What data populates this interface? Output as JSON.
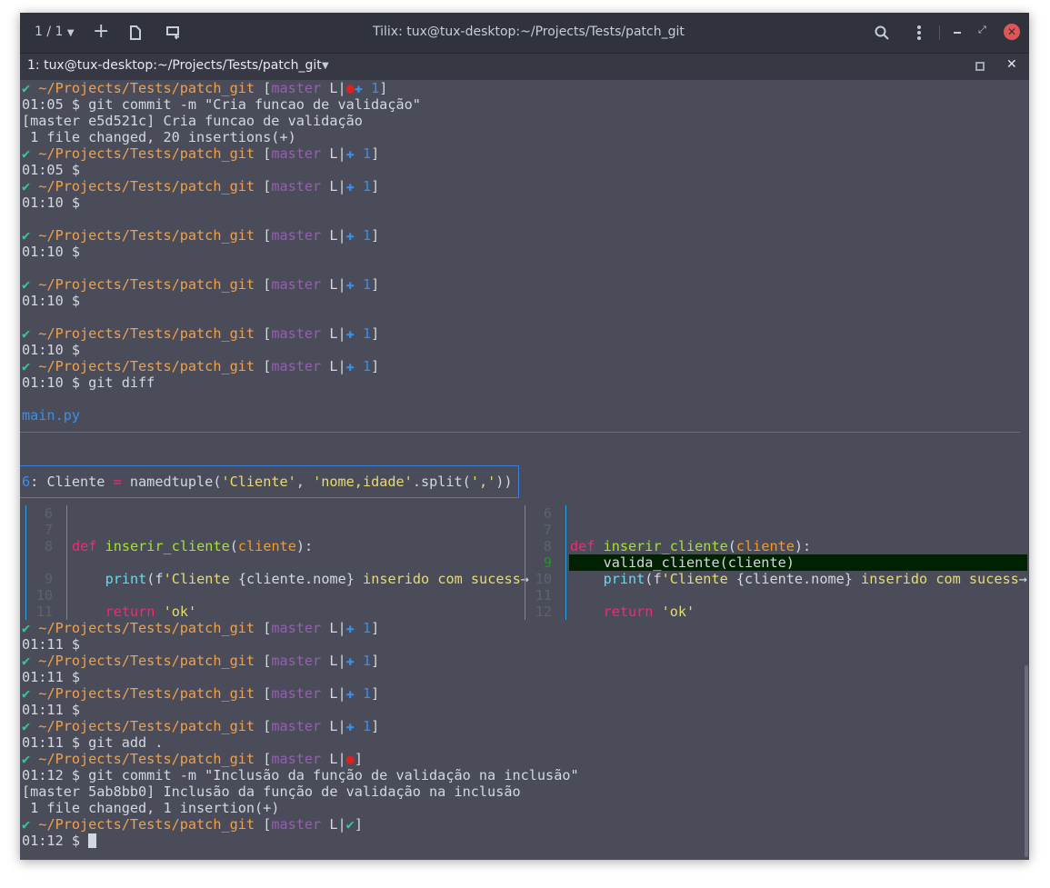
{
  "colors": {
    "fg": "#d3d7de",
    "path": "#f0a04b",
    "branch": "#9a5cb4",
    "check": "#3ec29a",
    "blue": "#3b8eea",
    "red": "#e0201e",
    "kw": "#f92672",
    "func": "#a6e22e",
    "param": "#fd971f",
    "str": "#e6db74",
    "builtin": "#66d9ef",
    "num": "#5e626c",
    "addnum": "#1f9a1f",
    "file": "#3b8eea",
    "close": "#e05555"
  },
  "titlebar": {
    "session_label": "1 / 1",
    "title": "Tilix: tux@tux-desktop:~/Projects/Tests/patch_git"
  },
  "tab": {
    "label": "1: tux@tux-desktop:~/Projects/Tests/patch_git"
  },
  "terminal": {
    "before": [
      [
        [
          "✔ ",
          "check"
        ],
        [
          "~/Projects/Tests/patch_git ",
          "path"
        ],
        [
          "[",
          "fg"
        ],
        [
          "master",
          "branch"
        ],
        [
          " L|",
          "fg"
        ],
        [
          "●",
          "red"
        ],
        [
          "✚",
          "blue"
        ],
        [
          " 1",
          "blue"
        ],
        [
          "]",
          "fg"
        ]
      ],
      [
        [
          "01:05 $ git commit -m \"Cria funcao de validação\"",
          "fg"
        ]
      ],
      [
        [
          "[master e5d521c] Cria funcao de validação",
          "fg"
        ]
      ],
      [
        [
          " 1 file changed, 20 insertions(+)",
          "fg"
        ]
      ],
      [
        [
          "✔ ",
          "check"
        ],
        [
          "~/Projects/Tests/patch_git ",
          "path"
        ],
        [
          "[",
          "fg"
        ],
        [
          "master",
          "branch"
        ],
        [
          " L|",
          "fg"
        ],
        [
          "✚",
          "blue"
        ],
        [
          " 1",
          "blue"
        ],
        [
          "]",
          "fg"
        ]
      ],
      [
        [
          "01:05 $",
          "fg"
        ]
      ],
      [
        [
          "✔ ",
          "check"
        ],
        [
          "~/Projects/Tests/patch_git ",
          "path"
        ],
        [
          "[",
          "fg"
        ],
        [
          "master",
          "branch"
        ],
        [
          " L|",
          "fg"
        ],
        [
          "✚",
          "blue"
        ],
        [
          " 1",
          "blue"
        ],
        [
          "]",
          "fg"
        ]
      ],
      [
        [
          "01:10 $",
          "fg"
        ]
      ],
      [],
      [
        [
          "✔ ",
          "check"
        ],
        [
          "~/Projects/Tests/patch_git ",
          "path"
        ],
        [
          "[",
          "fg"
        ],
        [
          "master",
          "branch"
        ],
        [
          " L|",
          "fg"
        ],
        [
          "✚",
          "blue"
        ],
        [
          " 1",
          "blue"
        ],
        [
          "]",
          "fg"
        ]
      ],
      [
        [
          "01:10 $",
          "fg"
        ]
      ],
      [],
      [
        [
          "✔ ",
          "check"
        ],
        [
          "~/Projects/Tests/patch_git ",
          "path"
        ],
        [
          "[",
          "fg"
        ],
        [
          "master",
          "branch"
        ],
        [
          " L|",
          "fg"
        ],
        [
          "✚",
          "blue"
        ],
        [
          " 1",
          "blue"
        ],
        [
          "]",
          "fg"
        ]
      ],
      [
        [
          "01:10 $",
          "fg"
        ]
      ],
      [],
      [
        [
          "✔ ",
          "check"
        ],
        [
          "~/Projects/Tests/patch_git ",
          "path"
        ],
        [
          "[",
          "fg"
        ],
        [
          "master",
          "branch"
        ],
        [
          " L|",
          "fg"
        ],
        [
          "✚",
          "blue"
        ],
        [
          " 1",
          "blue"
        ],
        [
          "]",
          "fg"
        ]
      ],
      [
        [
          "01:10 $",
          "fg"
        ]
      ],
      [
        [
          "✔ ",
          "check"
        ],
        [
          "~/Projects/Tests/patch_git ",
          "path"
        ],
        [
          "[",
          "fg"
        ],
        [
          "master",
          "branch"
        ],
        [
          " L|",
          "fg"
        ],
        [
          "✚",
          "blue"
        ],
        [
          " 1",
          "blue"
        ],
        [
          "]",
          "fg"
        ]
      ],
      [
        [
          "01:10 $ git diff",
          "fg"
        ]
      ],
      [],
      [
        [
          "main.py",
          "file"
        ]
      ]
    ],
    "diff": {
      "hunk": [
        [
          "6",
          "blue"
        ],
        [
          ": Cliente ",
          "fg"
        ],
        [
          "=",
          "kw"
        ],
        [
          " namedtuple(",
          "fg"
        ],
        [
          "'Cliente'",
          "str"
        ],
        [
          ", ",
          "fg"
        ],
        [
          "'nome,idade'",
          "str"
        ],
        [
          ".split(",
          "fg"
        ],
        [
          "','",
          "str"
        ],
        [
          "))",
          "fg"
        ]
      ],
      "left": [
        {
          "n": "6",
          "code": []
        },
        {
          "n": "7",
          "code": []
        },
        {
          "n": "8",
          "code": [
            [
              "def ",
              "kw"
            ],
            [
              "inserir_cliente",
              "func"
            ],
            [
              "(",
              "fg"
            ],
            [
              "cliente",
              "param"
            ],
            [
              "):",
              "fg"
            ]
          ]
        },
        {
          "n": "",
          "code": []
        },
        {
          "n": "9",
          "code": [
            [
              "    ",
              "fg"
            ],
            [
              "print",
              "builtin"
            ],
            [
              "(f",
              "fg"
            ],
            [
              "'Cliente ",
              "str"
            ],
            [
              "{cliente.nome}",
              "fg"
            ],
            [
              " inserido com sucess",
              "str"
            ],
            [
              "→",
              "fg"
            ]
          ]
        },
        {
          "n": "10",
          "code": []
        },
        {
          "n": "11",
          "code": [
            [
              "    ",
              "fg"
            ],
            [
              "return ",
              "kw"
            ],
            [
              "'ok'",
              "str"
            ]
          ]
        }
      ],
      "right": [
        {
          "n": "6",
          "code": []
        },
        {
          "n": "7",
          "code": []
        },
        {
          "n": "8",
          "code": [
            [
              "def ",
              "kw"
            ],
            [
              "inserir_cliente",
              "func"
            ],
            [
              "(",
              "fg"
            ],
            [
              "cliente",
              "param"
            ],
            [
              "):",
              "fg"
            ]
          ]
        },
        {
          "n": "9",
          "added": true,
          "code": [
            [
              "    valida_cliente(cliente)",
              "fg"
            ]
          ]
        },
        {
          "n": "10",
          "code": [
            [
              "    ",
              "fg"
            ],
            [
              "print",
              "builtin"
            ],
            [
              "(f",
              "fg"
            ],
            [
              "'Cliente ",
              "str"
            ],
            [
              "{cliente.nome}",
              "fg"
            ],
            [
              " inserido com sucess",
              "str"
            ],
            [
              "→",
              "fg"
            ]
          ]
        },
        {
          "n": "11",
          "code": []
        },
        {
          "n": "12",
          "code": [
            [
              "    ",
              "fg"
            ],
            [
              "return ",
              "kw"
            ],
            [
              "'ok'",
              "str"
            ]
          ]
        }
      ]
    },
    "after": [
      [
        [
          "✔ ",
          "check"
        ],
        [
          "~/Projects/Tests/patch_git ",
          "path"
        ],
        [
          "[",
          "fg"
        ],
        [
          "master",
          "branch"
        ],
        [
          " L|",
          "fg"
        ],
        [
          "✚",
          "blue"
        ],
        [
          " 1",
          "blue"
        ],
        [
          "]",
          "fg"
        ]
      ],
      [
        [
          "01:11 $",
          "fg"
        ]
      ],
      [
        [
          "✔ ",
          "check"
        ],
        [
          "~/Projects/Tests/patch_git ",
          "path"
        ],
        [
          "[",
          "fg"
        ],
        [
          "master",
          "branch"
        ],
        [
          " L|",
          "fg"
        ],
        [
          "✚",
          "blue"
        ],
        [
          " 1",
          "blue"
        ],
        [
          "]",
          "fg"
        ]
      ],
      [
        [
          "01:11 $",
          "fg"
        ]
      ],
      [
        [
          "✔ ",
          "check"
        ],
        [
          "~/Projects/Tests/patch_git ",
          "path"
        ],
        [
          "[",
          "fg"
        ],
        [
          "master",
          "branch"
        ],
        [
          " L|",
          "fg"
        ],
        [
          "✚",
          "blue"
        ],
        [
          " 1",
          "blue"
        ],
        [
          "]",
          "fg"
        ]
      ],
      [
        [
          "01:11 $",
          "fg"
        ]
      ],
      [
        [
          "✔ ",
          "check"
        ],
        [
          "~/Projects/Tests/patch_git ",
          "path"
        ],
        [
          "[",
          "fg"
        ],
        [
          "master",
          "branch"
        ],
        [
          " L|",
          "fg"
        ],
        [
          "✚",
          "blue"
        ],
        [
          " 1",
          "blue"
        ],
        [
          "]",
          "fg"
        ]
      ],
      [
        [
          "01:11 $ git add .",
          "fg"
        ]
      ],
      [
        [
          "✔ ",
          "check"
        ],
        [
          "~/Projects/Tests/patch_git ",
          "path"
        ],
        [
          "[",
          "fg"
        ],
        [
          "master",
          "branch"
        ],
        [
          " L|",
          "fg"
        ],
        [
          "●",
          "red"
        ],
        [
          "]",
          "fg"
        ]
      ],
      [
        [
          "01:12 $ git commit -m \"Inclusão da função de validação na inclusão\"",
          "fg"
        ]
      ],
      [
        [
          "[master 5ab8bb0] Inclusão da função de validação na inclusão",
          "fg"
        ]
      ],
      [
        [
          " 1 file changed, 1 insertion(+)",
          "fg"
        ]
      ],
      [
        [
          "✔ ",
          "check"
        ],
        [
          "~/Projects/Tests/patch_git ",
          "path"
        ],
        [
          "[",
          "fg"
        ],
        [
          "master",
          "branch"
        ],
        [
          " L|",
          "fg"
        ],
        [
          "✔",
          "check"
        ],
        [
          "]",
          "fg"
        ]
      ],
      [
        [
          "01:12 $ ",
          "fg"
        ]
      ]
    ]
  }
}
